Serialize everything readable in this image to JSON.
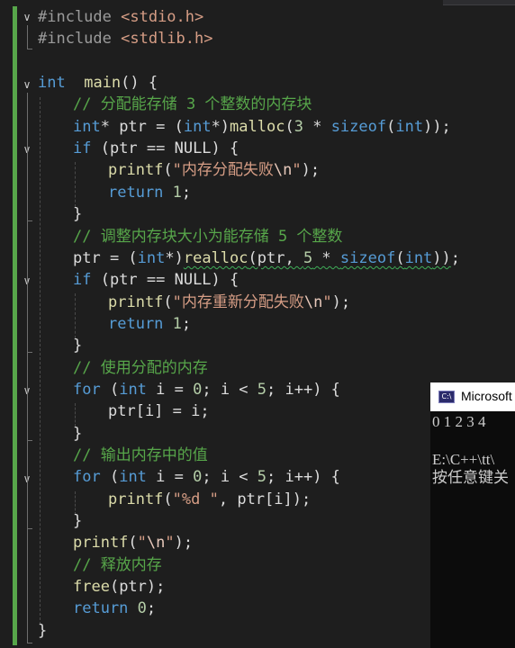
{
  "editor": {
    "lines": [
      {
        "indent": 0,
        "tokens": [
          [
            "pp",
            "#include "
          ],
          [
            "inc",
            "<stdio.h>"
          ]
        ]
      },
      {
        "indent": 0,
        "tokens": [
          [
            "pp",
            "#include "
          ],
          [
            "inc",
            "<stdlib.h>"
          ]
        ]
      },
      {
        "indent": 0,
        "tokens": []
      },
      {
        "indent": 0,
        "tokens": [
          [
            "ty",
            "int"
          ],
          [
            "",
            "  "
          ],
          [
            "fn",
            "main"
          ],
          [
            "",
            "() {"
          ]
        ]
      },
      {
        "indent": 1,
        "tokens": [
          [
            "cmt",
            "// 分配能存储 3 个整数的内存块"
          ]
        ]
      },
      {
        "indent": 1,
        "tokens": [
          [
            "ty",
            "int"
          ],
          [
            "",
            "* ptr = ("
          ],
          [
            "ty",
            "int"
          ],
          [
            "",
            "*)"
          ],
          [
            "fn",
            "malloc"
          ],
          [
            "",
            "("
          ],
          [
            "num",
            "3"
          ],
          [
            "",
            " * "
          ],
          [
            "kw",
            "sizeof"
          ],
          [
            "",
            "("
          ],
          [
            "ty",
            "int"
          ],
          [
            "",
            "));"
          ]
        ]
      },
      {
        "indent": 1,
        "tokens": [
          [
            "kw",
            "if"
          ],
          [
            "",
            " (ptr == NULL) {"
          ]
        ]
      },
      {
        "indent": 2,
        "tokens": [
          [
            "fn",
            "printf"
          ],
          [
            "",
            "("
          ],
          [
            "str",
            "\"内存分配失败"
          ],
          [
            "esc",
            "\\n"
          ],
          [
            "str",
            "\""
          ],
          [
            "",
            ");"
          ]
        ]
      },
      {
        "indent": 2,
        "tokens": [
          [
            "kw",
            "return"
          ],
          [
            "",
            " "
          ],
          [
            "num",
            "1"
          ],
          [
            "",
            ";"
          ]
        ]
      },
      {
        "indent": 1,
        "tokens": [
          [
            "",
            "}"
          ]
        ]
      },
      {
        "indent": 1,
        "tokens": [
          [
            "cmt",
            "// 调整内存块大小为能存储 5 个整数"
          ]
        ]
      },
      {
        "indent": 1,
        "tokens": [
          [
            "",
            "ptr = ("
          ],
          [
            "ty",
            "int"
          ],
          [
            "",
            "*)"
          ],
          [
            "fn squig",
            "realloc"
          ],
          [
            "squig",
            "(ptr, "
          ],
          [
            "num squig",
            "5"
          ],
          [
            "squig",
            " * "
          ],
          [
            "kw squig",
            "sizeof"
          ],
          [
            "squig",
            "("
          ],
          [
            "ty squig",
            "int"
          ],
          [
            "squig",
            "))"
          ],
          [
            "",
            ";"
          ]
        ]
      },
      {
        "indent": 1,
        "tokens": [
          [
            "kw",
            "if"
          ],
          [
            "",
            " (ptr == NULL) {"
          ]
        ]
      },
      {
        "indent": 2,
        "tokens": [
          [
            "fn",
            "printf"
          ],
          [
            "",
            "("
          ],
          [
            "str",
            "\"内存重新分配失败"
          ],
          [
            "esc",
            "\\n"
          ],
          [
            "str",
            "\""
          ],
          [
            "",
            ");"
          ]
        ]
      },
      {
        "indent": 2,
        "tokens": [
          [
            "kw",
            "return"
          ],
          [
            "",
            " "
          ],
          [
            "num",
            "1"
          ],
          [
            "",
            ";"
          ]
        ]
      },
      {
        "indent": 1,
        "tokens": [
          [
            "",
            "}"
          ]
        ]
      },
      {
        "indent": 1,
        "tokens": [
          [
            "cmt",
            "// 使用分配的内存"
          ]
        ]
      },
      {
        "indent": 1,
        "tokens": [
          [
            "kw",
            "for"
          ],
          [
            "",
            " ("
          ],
          [
            "ty",
            "int"
          ],
          [
            "",
            " i = "
          ],
          [
            "num",
            "0"
          ],
          [
            "",
            "; i < "
          ],
          [
            "num",
            "5"
          ],
          [
            "",
            "; i++) {"
          ]
        ]
      },
      {
        "indent": 2,
        "tokens": [
          [
            "",
            "ptr[i] = i;"
          ]
        ]
      },
      {
        "indent": 1,
        "tokens": [
          [
            "",
            "}"
          ]
        ]
      },
      {
        "indent": 1,
        "tokens": [
          [
            "cmt",
            "// 输出内存中的值"
          ]
        ]
      },
      {
        "indent": 1,
        "tokens": [
          [
            "kw",
            "for"
          ],
          [
            "",
            " ("
          ],
          [
            "ty",
            "int"
          ],
          [
            "",
            " i = "
          ],
          [
            "num",
            "0"
          ],
          [
            "",
            "; i < "
          ],
          [
            "num",
            "5"
          ],
          [
            "",
            "; i++) {"
          ]
        ]
      },
      {
        "indent": 2,
        "tokens": [
          [
            "fn",
            "printf"
          ],
          [
            "",
            "("
          ],
          [
            "str",
            "\"%d \""
          ],
          [
            "",
            ", ptr[i]);"
          ]
        ]
      },
      {
        "indent": 1,
        "tokens": [
          [
            "",
            "}"
          ]
        ]
      },
      {
        "indent": 1,
        "tokens": [
          [
            "fn",
            "printf"
          ],
          [
            "",
            "("
          ],
          [
            "str",
            "\""
          ],
          [
            "esc",
            "\\n"
          ],
          [
            "str",
            "\""
          ],
          [
            "",
            ");"
          ]
        ]
      },
      {
        "indent": 1,
        "tokens": [
          [
            "cmt",
            "// 释放内存"
          ]
        ]
      },
      {
        "indent": 1,
        "tokens": [
          [
            "fn",
            "free"
          ],
          [
            "",
            "(ptr);"
          ]
        ]
      },
      {
        "indent": 1,
        "tokens": [
          [
            "kw",
            "return"
          ],
          [
            "",
            " "
          ],
          [
            "num",
            "0"
          ],
          [
            "",
            ";"
          ]
        ]
      },
      {
        "indent": 0,
        "tokens": [
          [
            "",
            "}"
          ]
        ]
      }
    ]
  },
  "console": {
    "title": "Microsoft",
    "icon": "console-app-icon",
    "output_line1": "0 1 2 3 4",
    "output_line2": "E:\\C++\\tt\\",
    "output_line3": "按任意键关"
  },
  "colors": {
    "background": "#1e1e1e",
    "keyword": "#569cd6",
    "function": "#dcdcaa",
    "string": "#d69d85",
    "comment": "#57a64a",
    "number": "#b5cea8",
    "change_bar": "#57a64a",
    "squiggle": "#3fae58"
  }
}
